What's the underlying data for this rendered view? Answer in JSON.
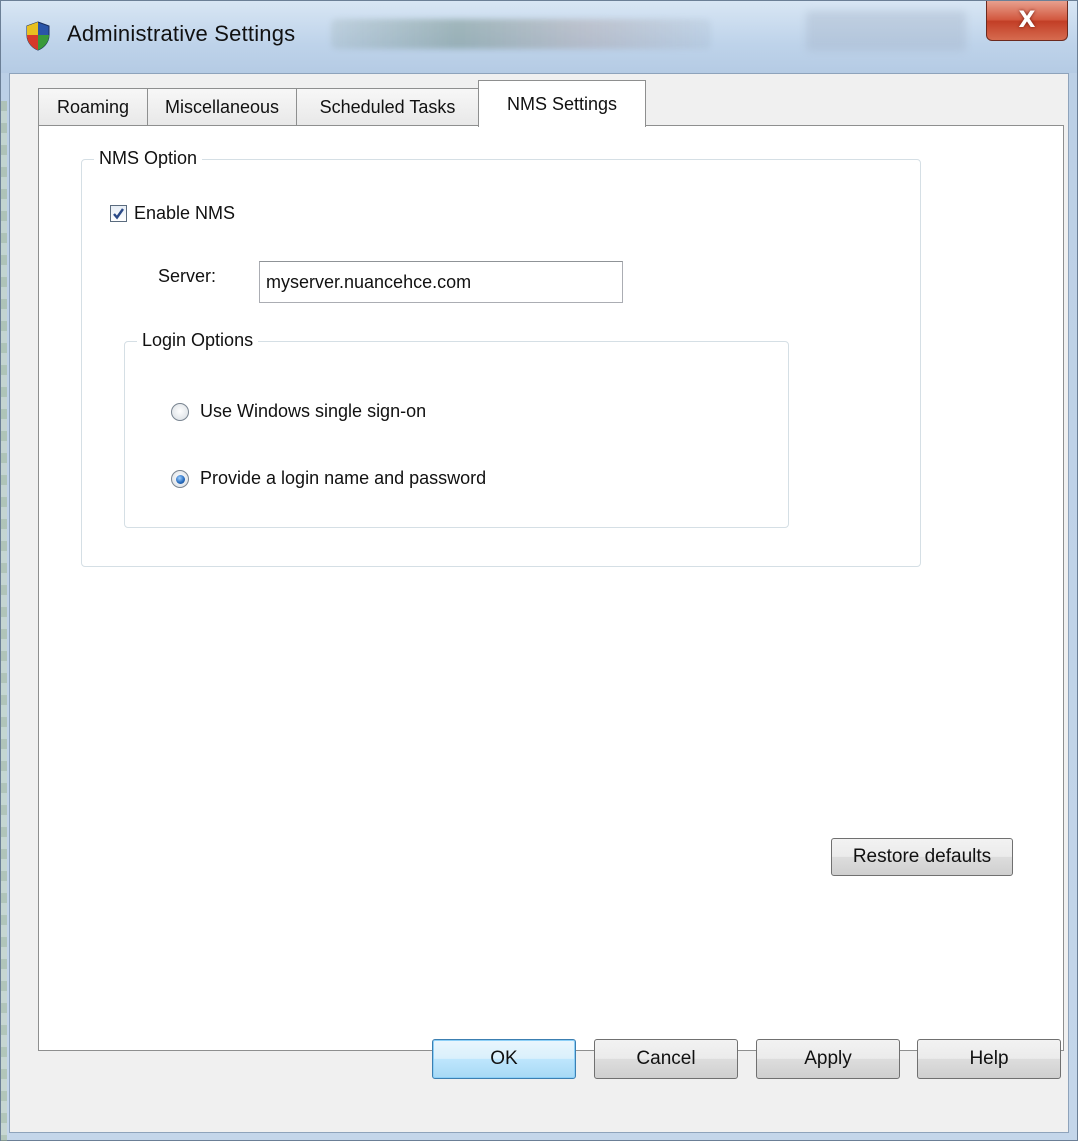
{
  "window": {
    "title": "Administrative Settings",
    "close_glyph": "X",
    "icon": "shield-icon"
  },
  "tabs": [
    {
      "label": "Roaming",
      "active": false
    },
    {
      "label": "Miscellaneous",
      "active": false
    },
    {
      "label": "Scheduled Tasks",
      "active": false
    },
    {
      "label": "NMS Settings",
      "active": true
    }
  ],
  "nms_option": {
    "group_label": "NMS Option",
    "enable_label": "Enable NMS",
    "enable_checked": true,
    "server_label": "Server:",
    "server_value": "myserver.nuancehce.com"
  },
  "login_options": {
    "group_label": "Login Options",
    "options": [
      {
        "label": "Use Windows single sign-on",
        "selected": false
      },
      {
        "label": "Provide a login name and password",
        "selected": true
      }
    ]
  },
  "restore_defaults_label": "Restore defaults",
  "footer": {
    "ok_label": "OK",
    "cancel_label": "Cancel",
    "apply_label": "Apply",
    "help_label": "Help"
  },
  "colors": {
    "accent": "#3c7fb1",
    "close_red": "#c23e26"
  }
}
